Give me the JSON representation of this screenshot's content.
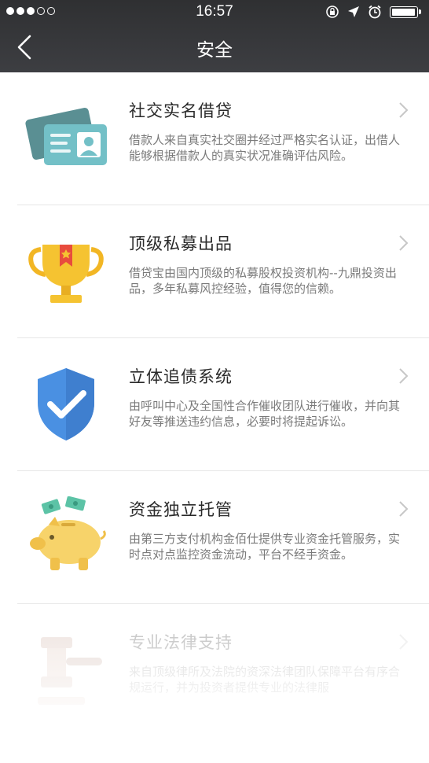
{
  "status_bar": {
    "time": "16:57",
    "signal_dots": 5,
    "battery_level": 0.95
  },
  "nav": {
    "title": "安全",
    "back_icon": "chevron-left-icon"
  },
  "features": [
    {
      "icon": "id-card-icon",
      "title": "社交实名借贷",
      "description": "借款人来自真实社交圈并经过严格实名认证，出借人能够根据借款人的真实状况准确评估风险。"
    },
    {
      "icon": "trophy-icon",
      "title": "顶级私募出品",
      "description": "借贷宝由国内顶级的私募股权投资机构--九鼎投资出品，多年私募风控经验，值得您的信赖。"
    },
    {
      "icon": "shield-check-icon",
      "title": "立体追债系统",
      "description": "由呼叫中心及全国性合作催收团队进行催收，并向其好友等推送违约信息，必要时将提起诉讼。"
    },
    {
      "icon": "piggy-bank-icon",
      "title": "资金独立托管",
      "description": "由第三方支付机构金佰仕提供专业资金托管服务，实时点对点监控资金流动，平台不经手资金。"
    },
    {
      "icon": "gavel-icon",
      "title": "专业法律支持",
      "description": "来自顶级律所及法院的资深法律团队保障平台有序合规运行，并为投资者提供专业的法律服"
    }
  ],
  "colors": {
    "nav_bg": "#34353a",
    "card_teal": "#5a9aa0",
    "trophy_gold": "#f5c331",
    "shield_blue": "#4a90e2",
    "piggy_yellow": "#f7d36a"
  }
}
